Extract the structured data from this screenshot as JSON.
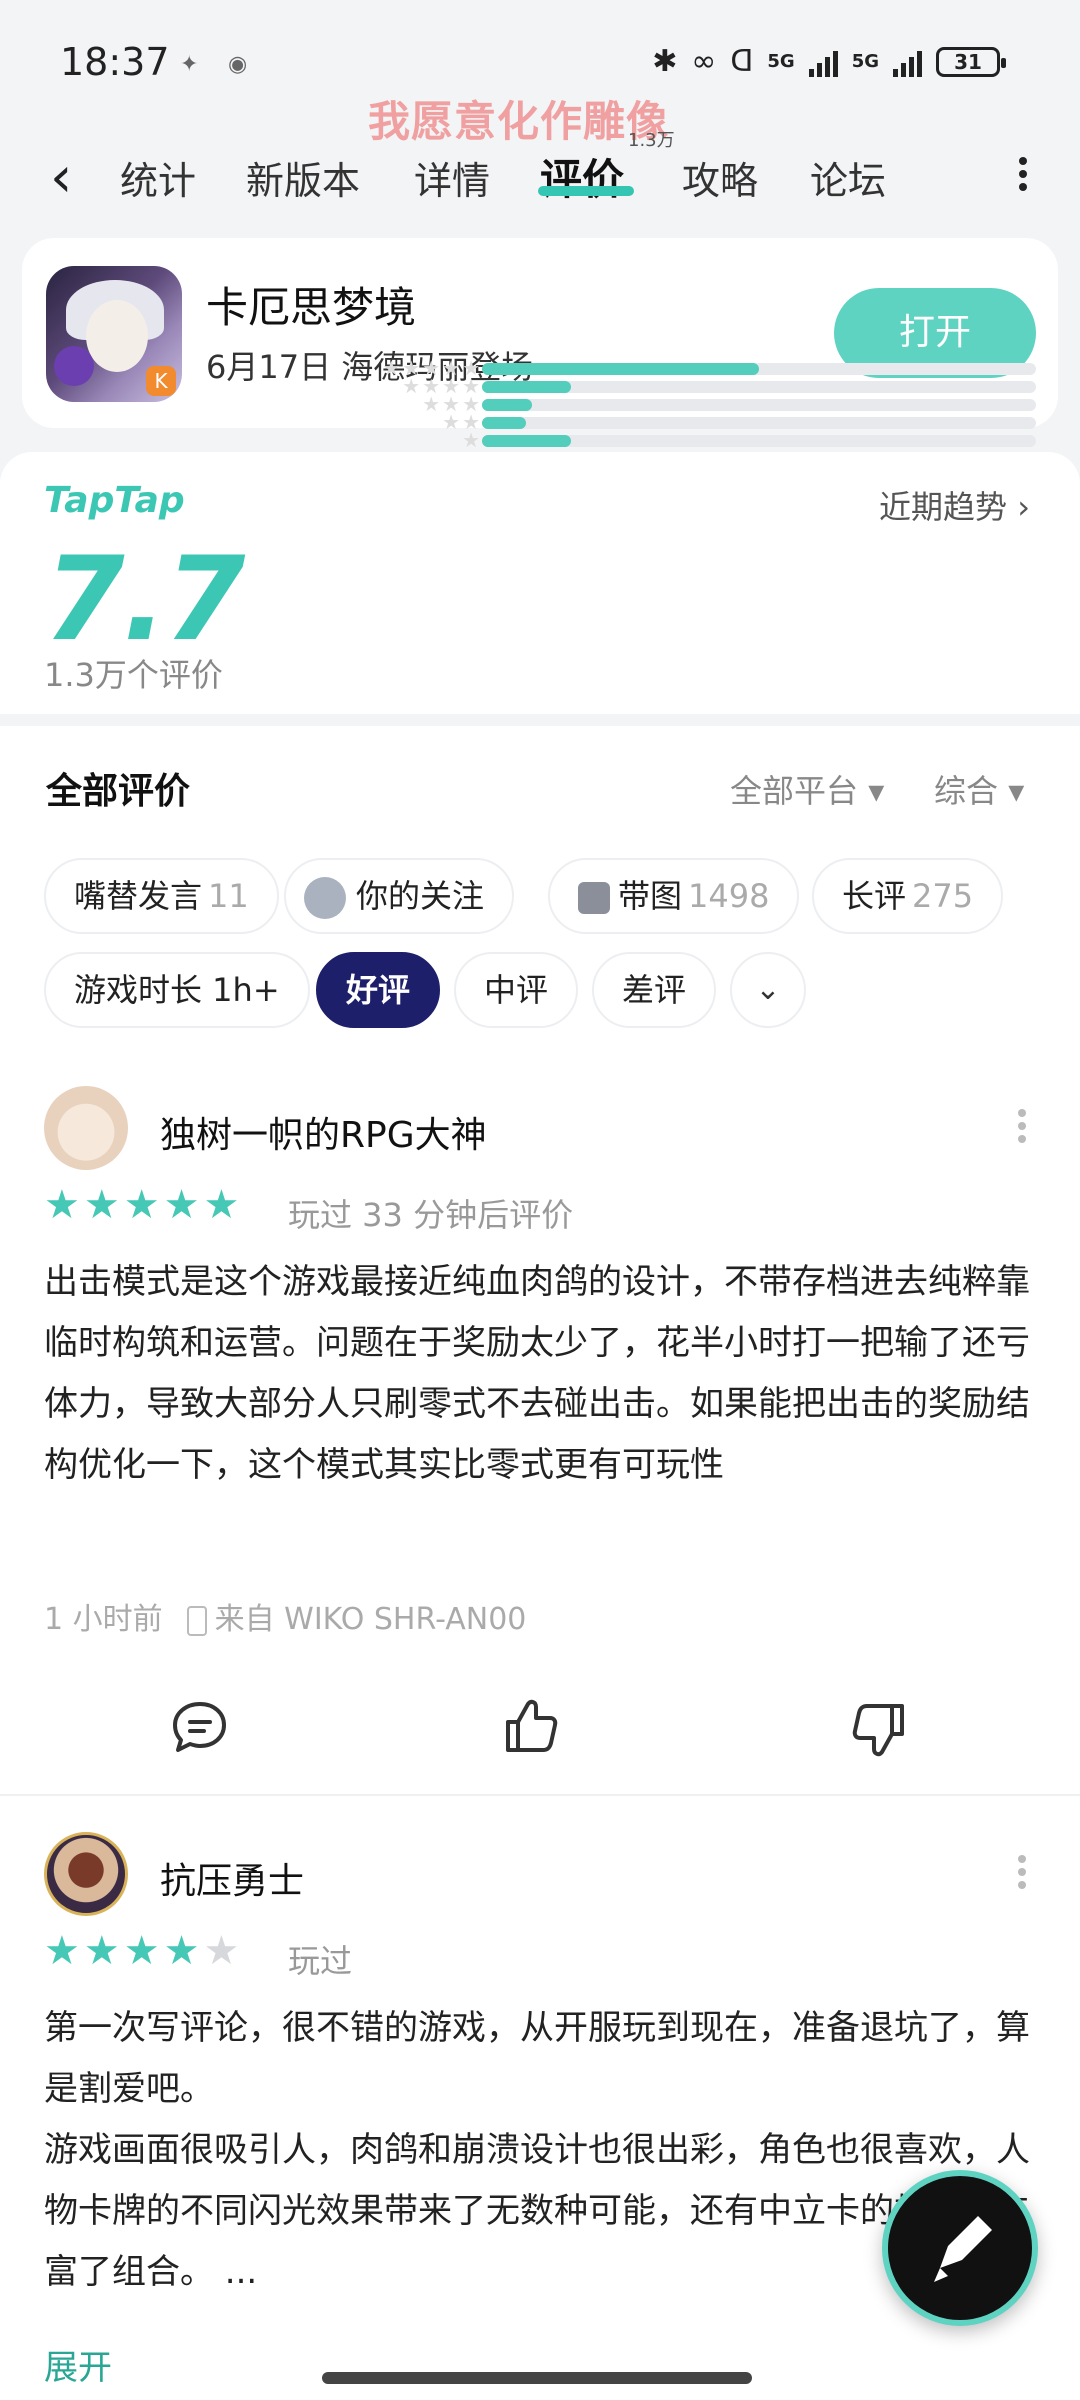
{
  "status_bar": {
    "time": "18:37",
    "network_label_1": "5G",
    "network_label_2": "5G",
    "battery": "31"
  },
  "overlay_banner": "我愿意化作雕像",
  "tabs": [
    {
      "label": "统计"
    },
    {
      "label": "新版本"
    },
    {
      "label": "详情"
    },
    {
      "label": "评价",
      "count": "1.3万",
      "active": true
    },
    {
      "label": "攻略"
    },
    {
      "label": "论坛"
    }
  ],
  "app": {
    "name": "卡厄思梦境",
    "subtitle": "6月17日 海德玛丽登场",
    "open_label": "打开"
  },
  "rating": {
    "brand": "TapTap",
    "trend_label": "近期趋势 ›",
    "score": "7.7",
    "count_label": "1.3万个评价",
    "distribution": [
      {
        "stars": 5,
        "fraction": 0.5
      },
      {
        "stars": 4,
        "fraction": 0.16
      },
      {
        "stars": 3,
        "fraction": 0.09
      },
      {
        "stars": 2,
        "fraction": 0.08
      },
      {
        "stars": 1,
        "fraction": 0.16
      }
    ]
  },
  "reviews_section": {
    "title": "全部评价",
    "platform_filter": "全部平台",
    "sort_filter": "综合",
    "chips": [
      {
        "label": "嘴替发言",
        "count": "11"
      },
      {
        "label": "你的关注",
        "count": ""
      },
      {
        "label": "带图",
        "count": "1498"
      },
      {
        "label": "长评",
        "count": "275"
      },
      {
        "label": "游戏时长 1h+",
        "count": ""
      },
      {
        "label": "好评",
        "count": "",
        "active": true
      },
      {
        "label": "中评",
        "count": ""
      },
      {
        "label": "差评",
        "count": ""
      }
    ]
  },
  "reviews": [
    {
      "username": "独树一帜的RPG大神",
      "stars": 5,
      "played": "玩过 33 分钟后评价",
      "body": "出击模式是这个游戏最接近纯血肉鸽的设计，不带存档进去纯粹靠临时构筑和运营。问题在于奖励太少了，花半小时打一把输了还亏体力，导致大部分人只刷零式不去碰出击。如果能把出击的奖励结构优化一下，这个模式其实比零式更有可玩性",
      "time": "1 小时前",
      "device": "来自 WIKO SHR-AN00"
    },
    {
      "username": "抗压勇士",
      "stars": 4,
      "played": "玩过",
      "body": "第一次写评论，很不错的游戏，从开服玩到现在，准备退坑了，算是割爱吧。\n游戏画面很吸引人，肉鸽和崩溃设计也很出彩，角色也很喜欢，人物卡牌的不同闪光效果带来了无数种可能，还有中立卡的加入也丰富了组合。 ...",
      "expand_label": "展开"
    }
  ],
  "colors": {
    "accent": "#3cc7b4",
    "chip_active": "#1e1f6b",
    "background": "#f3f4f6"
  }
}
